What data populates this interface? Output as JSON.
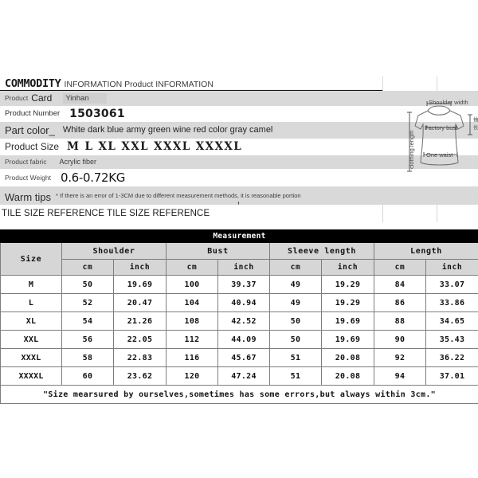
{
  "header": {
    "title_main": "COMMODITY",
    "title_sub": "INFORMATION Product INFORMATION"
  },
  "info_rows": {
    "product_card": {
      "label_small": "Product",
      "label_large": "Card",
      "value": "Yinhan"
    },
    "product_number": {
      "label": "Product Number",
      "value": "1503061"
    },
    "part_color": {
      "label": "Part color_",
      "value": "White dark blue army green wine red color gray camel"
    },
    "product_size": {
      "label": "Product Size",
      "value": "M L XL XXL XXXL XXXXL"
    },
    "product_fabric": {
      "label": "Product fabric",
      "value": "Acrylic fiber"
    },
    "product_weight": {
      "label": "Product Weight",
      "value": "0.6-0.72KG"
    },
    "warm_tips": {
      "label": "Warm tips",
      "comma": ",",
      "value": "* If there is an error of 1-3CM due to different measurement methods, it is reasonable portion"
    },
    "tile_reference": {
      "value": "TILE SIZE REFERENCE TILE SIZE REFERENCE"
    }
  },
  "diagram": {
    "shoulder_label": "Shoulder width",
    "bust_label": "Factory bust",
    "waist_label": "One waist",
    "length_label": "clothing length",
    "sleeve_label_cjk": "袖长"
  },
  "chart_data": {
    "type": "table",
    "title": "Measurement",
    "group_headers": [
      "Size",
      "Shoulder",
      "Bust",
      "Sleeve length",
      "Length"
    ],
    "unit_headers": [
      "cm",
      "inch",
      "cm",
      "inch",
      "cm",
      "inch",
      "cm",
      "inch"
    ],
    "categories": [
      "M",
      "L",
      "XL",
      "XXL",
      "XXXL",
      "XXXXL"
    ],
    "rows": [
      {
        "size": "M",
        "shoulder_cm": "50",
        "shoulder_inch": "19.69",
        "bust_cm": "100",
        "bust_inch": "39.37",
        "sleeve_cm": "49",
        "sleeve_inch": "19.29",
        "length_cm": "84",
        "length_inch": "33.07"
      },
      {
        "size": "L",
        "shoulder_cm": "52",
        "shoulder_inch": "20.47",
        "bust_cm": "104",
        "bust_inch": "40.94",
        "sleeve_cm": "49",
        "sleeve_inch": "19.29",
        "length_cm": "86",
        "length_inch": "33.86"
      },
      {
        "size": "XL",
        "shoulder_cm": "54",
        "shoulder_inch": "21.26",
        "bust_cm": "108",
        "bust_inch": "42.52",
        "sleeve_cm": "50",
        "sleeve_inch": "19.69",
        "length_cm": "88",
        "length_inch": "34.65"
      },
      {
        "size": "XXL",
        "shoulder_cm": "56",
        "shoulder_inch": "22.05",
        "bust_cm": "112",
        "bust_inch": "44.09",
        "sleeve_cm": "50",
        "sleeve_inch": "19.69",
        "length_cm": "90",
        "length_inch": "35.43"
      },
      {
        "size": "XXXL",
        "shoulder_cm": "58",
        "shoulder_inch": "22.83",
        "bust_cm": "116",
        "bust_inch": "45.67",
        "sleeve_cm": "51",
        "sleeve_inch": "20.08",
        "length_cm": "92",
        "length_inch": "36.22"
      },
      {
        "size": "XXXXL",
        "shoulder_cm": "60",
        "shoulder_inch": "23.62",
        "bust_cm": "120",
        "bust_inch": "47.24",
        "sleeve_cm": "51",
        "sleeve_inch": "20.08",
        "length_cm": "94",
        "length_inch": "37.01"
      }
    ],
    "footnote": "\"Size mearsured by ourselves,sometimes has some errors,but always within 3cm.\"",
    "series": [
      {
        "name": "Shoulder (cm)",
        "values": [
          50,
          52,
          54,
          56,
          58,
          60
        ]
      },
      {
        "name": "Shoulder (inch)",
        "values": [
          19.69,
          20.47,
          21.26,
          22.05,
          22.83,
          23.62
        ]
      },
      {
        "name": "Bust (cm)",
        "values": [
          100,
          104,
          108,
          112,
          116,
          120
        ]
      },
      {
        "name": "Bust (inch)",
        "values": [
          39.37,
          40.94,
          42.52,
          44.09,
          45.67,
          47.24
        ]
      },
      {
        "name": "Sleeve length (cm)",
        "values": [
          49,
          49,
          50,
          50,
          51,
          51
        ]
      },
      {
        "name": "Sleeve length (inch)",
        "values": [
          19.29,
          19.29,
          19.69,
          19.69,
          20.08,
          20.08
        ]
      },
      {
        "name": "Length (cm)",
        "values": [
          84,
          86,
          88,
          90,
          92,
          94
        ]
      },
      {
        "name": "Length (inch)",
        "values": [
          33.07,
          33.86,
          34.65,
          35.43,
          36.22,
          37.01
        ]
      }
    ]
  },
  "colors": {
    "shade_row": "#d9d9d9",
    "table_header": "#d6d6d6",
    "title_bar": "#000000",
    "border": "#7d7d7d"
  }
}
